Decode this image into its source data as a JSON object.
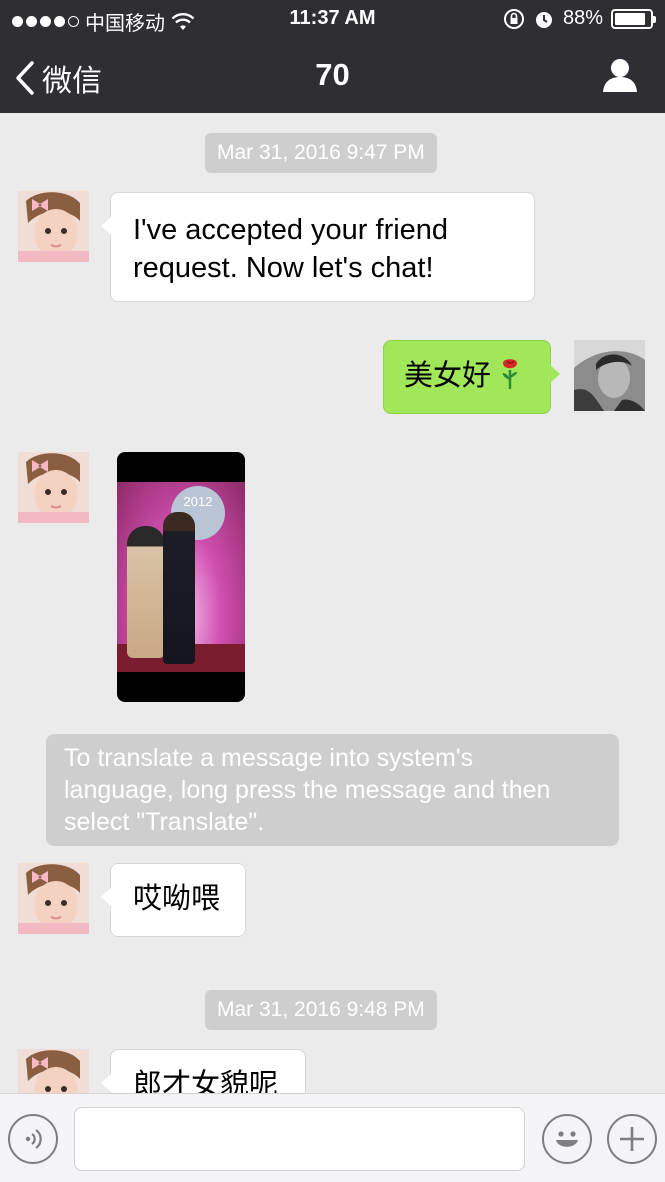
{
  "status_bar": {
    "carrier": "中国移动",
    "time": "11:37 AM",
    "battery": "88%",
    "battery_level": 0.88,
    "signal_bars_filled": 4,
    "signal_bars_total": 5
  },
  "nav": {
    "back_label": "微信",
    "title": "70"
  },
  "messages": [
    {
      "type": "timestamp",
      "text": "Mar 31, 2016 9:47 PM"
    },
    {
      "type": "incoming_text",
      "text_line1": "I've accepted your friend",
      "text_line2": "request. Now let's chat!"
    },
    {
      "type": "outgoing_text",
      "text": "美女好"
    },
    {
      "type": "incoming_image",
      "overlay_text": "2012"
    },
    {
      "type": "system",
      "text_line1": "To translate a message into system's",
      "text_line2": "language, long press the message and then",
      "text_line3": "select \"Translate\"."
    },
    {
      "type": "incoming_text",
      "text": "哎呦喂"
    },
    {
      "type": "timestamp",
      "text": "Mar 31, 2016 9:48 PM"
    },
    {
      "type": "incoming_text",
      "text": "郎才女貌呢"
    }
  ],
  "input_bar": {
    "voice_icon": "voice-icon",
    "emoji_icon": "emoji-icon",
    "plus_icon": "plus-icon",
    "input_value": ""
  },
  "colors": {
    "nav_background": "#2e2e33",
    "chat_background": "#ebebeb",
    "outgoing_bubble": "#a0e75a",
    "incoming_bubble": "#ffffff",
    "timestamp_background": "#cecece"
  }
}
